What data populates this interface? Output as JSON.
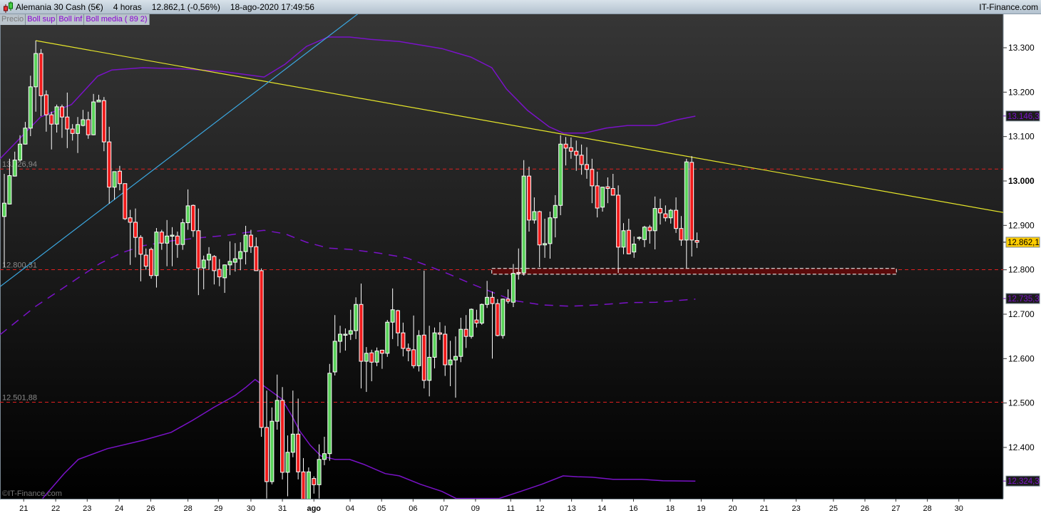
{
  "header": {
    "instrument": "Alemania 30 Cash (5€)",
    "timeframe": "4 horas",
    "quote": "12.862,1 (-0,56%)",
    "datetime": "18-ago-2020 17:49:56",
    "brand": "IT-Finance.com",
    "icon": "candlestick-icon"
  },
  "legend": {
    "price": "Precio",
    "boll_sup": "Boll sup",
    "boll_inf": "Boll inf",
    "boll_media": "Boll media ( 89 2)"
  },
  "watermark": "©IT-Finance.com",
  "colors": {
    "up": "#5ad35a",
    "down": "#f01c1c",
    "bollinger": "#7a12c8",
    "trendline_yellow": "#e6e62a",
    "trendline_blue": "#3ba7e0",
    "level_line": "#e02020",
    "last_price_bg": "#ffcc00"
  },
  "chart_data": {
    "type": "candlestick",
    "title": "",
    "ylim": [
      12285,
      13380
    ],
    "y_ticks": [
      {
        "value": 13300,
        "label": "13.300"
      },
      {
        "value": 13200,
        "label": "13.200"
      },
      {
        "value": 13100,
        "label": "13.100"
      },
      {
        "value": 13000,
        "label": "13.000",
        "bold": true
      },
      {
        "value": 12900,
        "label": "12.900"
      },
      {
        "value": 12800,
        "label": "12.800"
      },
      {
        "value": 12700,
        "label": "12.700"
      },
      {
        "value": 12600,
        "label": "12.600"
      },
      {
        "value": 12500,
        "label": "12.500"
      },
      {
        "value": 12400,
        "label": "12.400"
      }
    ],
    "x_ticks": [
      {
        "bar": 4.7,
        "label": "21"
      },
      {
        "bar": 10.8,
        "label": "22"
      },
      {
        "bar": 16.8,
        "label": "23"
      },
      {
        "bar": 22.9,
        "label": "24"
      },
      {
        "bar": 28.9,
        "label": "26"
      },
      {
        "bar": 36.0,
        "label": "28"
      },
      {
        "bar": 41.8,
        "label": "29"
      },
      {
        "bar": 48.0,
        "label": "30"
      },
      {
        "bar": 54.0,
        "label": "31"
      },
      {
        "bar": 60.0,
        "label": "ago",
        "bold": true
      },
      {
        "bar": 66.9,
        "label": "04"
      },
      {
        "bar": 72.9,
        "label": "05"
      },
      {
        "bar": 78.9,
        "label": "06"
      },
      {
        "bar": 84.8,
        "label": "07"
      },
      {
        "bar": 90.8,
        "label": "09"
      },
      {
        "bar": 97.5,
        "label": "11"
      },
      {
        "bar": 103.1,
        "label": "12"
      },
      {
        "bar": 109.1,
        "label": "13"
      },
      {
        "bar": 114.9,
        "label": "14"
      },
      {
        "bar": 120.9,
        "label": "16"
      },
      {
        "bar": 127.9,
        "label": "18"
      },
      {
        "bar": 133.8,
        "label": "19"
      },
      {
        "bar": 139.8,
        "label": "20"
      },
      {
        "bar": 145.8,
        "label": "21"
      },
      {
        "bar": 151.9,
        "label": "23"
      },
      {
        "bar": 159.0,
        "label": "25"
      },
      {
        "bar": 165.0,
        "label": "26"
      },
      {
        "bar": 170.9,
        "label": "27"
      },
      {
        "bar": 176.9,
        "label": "28"
      },
      {
        "bar": 182.9,
        "label": "30"
      }
    ],
    "ohlc_columns": [
      "open",
      "high",
      "low",
      "close"
    ],
    "candles": [
      [
        12920,
        13016,
        12806,
        12950
      ],
      [
        12948,
        13050,
        12947,
        13012
      ],
      [
        13011,
        13066,
        13010,
        13047
      ],
      [
        13047,
        13103,
        13044,
        13083
      ],
      [
        13083,
        13133,
        13082,
        13119
      ],
      [
        13119,
        13237,
        13101,
        13212
      ],
      [
        13212,
        13316,
        13156,
        13287
      ],
      [
        13287,
        13297,
        13146,
        13192
      ],
      [
        13194,
        13204,
        13111,
        13149
      ],
      [
        13149,
        13156,
        13071,
        13128
      ],
      [
        13128,
        13172,
        13109,
        13167
      ],
      [
        13167,
        13172,
        13097,
        13144
      ],
      [
        13144,
        13199,
        13074,
        13117
      ],
      [
        13117,
        13128,
        13091,
        13107
      ],
      [
        13107,
        13144,
        13063,
        13127
      ],
      [
        13125,
        13160,
        13123,
        13138
      ],
      [
        13138,
        13156,
        13095,
        13104
      ],
      [
        13104,
        13196,
        13103,
        13178
      ],
      [
        13178,
        13194,
        13178,
        13182
      ],
      [
        13181,
        13189,
        13067,
        13088
      ],
      [
        13088,
        13122,
        12949,
        12986
      ],
      [
        12986,
        13021,
        12958,
        13021
      ],
      [
        13022,
        13034,
        12979,
        12994
      ],
      [
        12994,
        12994,
        12912,
        12915
      ],
      [
        12917,
        12935,
        12811,
        12907
      ],
      [
        12907,
        12938,
        12828,
        12873
      ],
      [
        12873,
        12878,
        12774,
        12835
      ],
      [
        12833,
        12848,
        12800,
        12808
      ],
      [
        12846,
        12850,
        12780,
        12787
      ],
      [
        12787,
        12894,
        12760,
        12885
      ],
      [
        12885,
        12890,
        12845,
        12860
      ],
      [
        12860,
        12912,
        12808,
        12876
      ],
      [
        12876,
        12896,
        12808,
        12878
      ],
      [
        12876,
        12886,
        12827,
        12857
      ],
      [
        12857,
        12915,
        12845,
        12906
      ],
      [
        12906,
        12981,
        12890,
        12944
      ],
      [
        12945,
        12947,
        12874,
        12888
      ],
      [
        12888,
        12938,
        12743,
        12804
      ],
      [
        12804,
        12832,
        12756,
        12822
      ],
      [
        12822,
        12851,
        12800,
        12835
      ],
      [
        12830,
        12833,
        12767,
        12798
      ],
      [
        12801,
        12824,
        12763,
        12784
      ],
      [
        12782,
        12812,
        12748,
        12811
      ],
      [
        12811,
        12864,
        12788,
        12819
      ],
      [
        12817,
        12860,
        12796,
        12825
      ],
      [
        12825,
        12862,
        12799,
        12841
      ],
      [
        12841,
        12899,
        12812,
        12878
      ],
      [
        12878,
        12890,
        12838,
        12852
      ],
      [
        12852,
        12873,
        12798,
        12798
      ],
      [
        12798,
        12803,
        12424,
        12445
      ],
      [
        12445,
        12528,
        12285,
        12323
      ],
      [
        12323,
        12490,
        12317,
        12459
      ],
      [
        12459,
        12564,
        12440,
        12506
      ],
      [
        12506,
        12536,
        12328,
        12344
      ],
      [
        12344,
        12427,
        12290,
        12389
      ],
      [
        12389,
        12528,
        12378,
        12430
      ],
      [
        12430,
        12510,
        12328,
        12345
      ],
      [
        12345,
        12376,
        12270,
        12280
      ],
      [
        12280,
        12355,
        12270,
        12345
      ],
      [
        12330,
        12335,
        12296,
        12316
      ],
      [
        12316,
        12407,
        12285,
        12373
      ],
      [
        12373,
        12424,
        12360,
        12386
      ],
      [
        12386,
        12588,
        12370,
        12567
      ],
      [
        12570,
        12698,
        12562,
        12639
      ],
      [
        12639,
        12674,
        12613,
        12655
      ],
      [
        12655,
        12668,
        12618,
        12655
      ],
      [
        12655,
        12710,
        12642,
        12663
      ],
      [
        12663,
        12738,
        12644,
        12722
      ],
      [
        12722,
        12769,
        12533,
        12594
      ],
      [
        12594,
        12626,
        12525,
        12612
      ],
      [
        12613,
        12620,
        12549,
        12592
      ],
      [
        12592,
        12625,
        12583,
        12617
      ],
      [
        12619,
        12620,
        12577,
        12612
      ],
      [
        12612,
        12687,
        12604,
        12682
      ],
      [
        12682,
        12758,
        12644,
        12710
      ],
      [
        12708,
        12710,
        12628,
        12658
      ],
      [
        12658,
        12681,
        12605,
        12623
      ],
      [
        12623,
        12634,
        12594,
        12618
      ],
      [
        12620,
        12697,
        12578,
        12584
      ],
      [
        12584,
        12664,
        12571,
        12652
      ],
      [
        12653,
        12798,
        12533,
        12551
      ],
      [
        12551,
        12674,
        12515,
        12603
      ],
      [
        12603,
        12670,
        12578,
        12658
      ],
      [
        12658,
        12682,
        12642,
        12655
      ],
      [
        12655,
        12674,
        12561,
        12586
      ],
      [
        12586,
        12640,
        12538,
        12597
      ],
      [
        12597,
        12650,
        12512,
        12605
      ],
      [
        12605,
        12692,
        12592,
        12666
      ],
      [
        12666,
        12698,
        12624,
        12650
      ],
      [
        12650,
        12713,
        12645,
        12711
      ],
      [
        12687,
        12710,
        12670,
        12680
      ],
      [
        12680,
        12724,
        12676,
        12722
      ],
      [
        12722,
        12775,
        12714,
        12738
      ],
      [
        12738,
        12751,
        12600,
        12724
      ],
      [
        12724,
        12734,
        12650,
        12652
      ],
      [
        12652,
        12735,
        12645,
        12734
      ],
      [
        12734,
        12756,
        12724,
        12729
      ],
      [
        12727,
        12813,
        12716,
        12792
      ],
      [
        12794,
        12848,
        12778,
        12793
      ],
      [
        12793,
        13047,
        12787,
        13011
      ],
      [
        13011,
        13032,
        12886,
        12912
      ],
      [
        12912,
        12963,
        12904,
        12931
      ],
      [
        12931,
        12933,
        12806,
        12856
      ],
      [
        12856,
        12915,
        12827,
        12859
      ],
      [
        12859,
        12931,
        12825,
        12917
      ],
      [
        12917,
        12968,
        12873,
        12945
      ],
      [
        12945,
        13103,
        12923,
        13083
      ],
      [
        13083,
        13099,
        13035,
        13074
      ],
      [
        13075,
        13098,
        13050,
        13067
      ],
      [
        13067,
        13091,
        13023,
        13058
      ],
      [
        13058,
        13082,
        13014,
        13037
      ],
      [
        13037,
        13076,
        13005,
        13026
      ],
      [
        13026,
        13050,
        12950,
        12989
      ],
      [
        12989,
        13021,
        12918,
        12939
      ],
      [
        12941,
        12987,
        12931,
        12986
      ],
      [
        12987,
        13008,
        12950,
        12983
      ],
      [
        12983,
        13016,
        12968,
        12968
      ],
      [
        12968,
        12990,
        12793,
        12851
      ],
      [
        12851,
        12905,
        12835,
        12888
      ],
      [
        12889,
        12915,
        12835,
        12836
      ],
      [
        12840,
        12875,
        12827,
        12858
      ],
      [
        12872,
        12875,
        12866,
        12873
      ],
      [
        12868,
        12899,
        12851,
        12896
      ],
      [
        12896,
        12901,
        12859,
        12888
      ],
      [
        12888,
        12965,
        12846,
        12938
      ],
      [
        12938,
        12960,
        12902,
        12928
      ],
      [
        12926,
        12945,
        12909,
        12917
      ],
      [
        12917,
        12937,
        12904,
        12934
      ],
      [
        12934,
        12963,
        12883,
        12893
      ],
      [
        12893,
        12921,
        12854,
        12867
      ],
      [
        12867,
        13050,
        12804,
        13043
      ],
      [
        13042,
        13056,
        12830,
        12867
      ],
      [
        12866,
        12884,
        12849,
        12862
      ]
    ],
    "bollinger": {
      "period": 89,
      "deviation": 2,
      "upper": [
        [
          0.2,
          13050
        ],
        [
          7.9,
          13144
        ],
        [
          13.8,
          13172
        ],
        [
          18.8,
          13236
        ],
        [
          21.5,
          13250
        ],
        [
          27.4,
          13255
        ],
        [
          35.5,
          13252
        ],
        [
          42.3,
          13247
        ],
        [
          50.5,
          13234
        ],
        [
          54.5,
          13263
        ],
        [
          58.6,
          13303
        ],
        [
          62.7,
          13324
        ],
        [
          66.8,
          13324
        ],
        [
          70.8,
          13319
        ],
        [
          76.3,
          13314
        ],
        [
          84.4,
          13298
        ],
        [
          89.9,
          13279
        ],
        [
          93.9,
          13255
        ],
        [
          96.7,
          13207
        ],
        [
          100.7,
          13159
        ],
        [
          104.8,
          13122
        ],
        [
          107.5,
          13108
        ],
        [
          111.6,
          13108
        ],
        [
          115.7,
          13119
        ],
        [
          119.8,
          13125
        ],
        [
          125.2,
          13125
        ],
        [
          129.3,
          13138
        ],
        [
          132.7,
          13146
        ]
      ],
      "middle": [
        [
          0.2,
          12654
        ],
        [
          7.0,
          12718
        ],
        [
          11.1,
          12750
        ],
        [
          15.1,
          12782
        ],
        [
          19.2,
          12814
        ],
        [
          23.3,
          12838
        ],
        [
          27.4,
          12854
        ],
        [
          32.8,
          12865
        ],
        [
          38.2,
          12872
        ],
        [
          43.7,
          12878
        ],
        [
          47.7,
          12885
        ],
        [
          50.5,
          12889
        ],
        [
          54.5,
          12881
        ],
        [
          58.6,
          12862
        ],
        [
          62.7,
          12849
        ],
        [
          66.8,
          12846
        ],
        [
          72.2,
          12838
        ],
        [
          77.6,
          12827
        ],
        [
          81.7,
          12809
        ],
        [
          85.8,
          12790
        ],
        [
          89.9,
          12769
        ],
        [
          93.9,
          12750
        ],
        [
          98.0,
          12731
        ],
        [
          103.4,
          12721
        ],
        [
          108.9,
          12718
        ],
        [
          114.3,
          12721
        ],
        [
          119.8,
          12726
        ],
        [
          125.2,
          12727
        ],
        [
          132.7,
          12734
        ]
      ],
      "lower": [
        [
          8.3,
          12285
        ],
        [
          12.4,
          12341
        ],
        [
          15.1,
          12373
        ],
        [
          20.6,
          12397
        ],
        [
          27.4,
          12416
        ],
        [
          32.8,
          12434
        ],
        [
          36.9,
          12461
        ],
        [
          40.9,
          12490
        ],
        [
          45.0,
          12517
        ],
        [
          47.1,
          12536
        ],
        [
          48.8,
          12553
        ],
        [
          51.1,
          12533
        ],
        [
          53.9,
          12509
        ],
        [
          55.9,
          12469
        ],
        [
          57.3,
          12437
        ],
        [
          59.3,
          12405
        ],
        [
          61.3,
          12381
        ],
        [
          64.0,
          12373
        ],
        [
          66.8,
          12373
        ],
        [
          69.5,
          12362
        ],
        [
          73.6,
          12341
        ],
        [
          76.3,
          12336
        ],
        [
          80.3,
          12317
        ],
        [
          84.4,
          12301
        ],
        [
          87.1,
          12285
        ],
        [
          95.3,
          12285
        ],
        [
          99.4,
          12301
        ],
        [
          103.4,
          12317
        ],
        [
          107.5,
          12336
        ],
        [
          110.2,
          12334
        ],
        [
          113.0,
          12333
        ],
        [
          117.0,
          12328
        ],
        [
          122.5,
          12328
        ],
        [
          126.5,
          12325
        ],
        [
          132.7,
          12324
        ]
      ]
    },
    "trendlines": [
      {
        "color": "yellow",
        "points": [
          [
            7,
            13316
          ],
          [
            191.4,
            12929
          ]
        ]
      },
      {
        "color": "blue",
        "points": [
          [
            0.2,
            12762
          ],
          [
            68.8,
            13380
          ]
        ]
      }
    ],
    "levels": [
      {
        "value": 13026.94,
        "label": "13.026,94"
      },
      {
        "value": 12800.31,
        "label": "12.800,31"
      },
      {
        "value": 12501.88,
        "label": "12.501,88"
      }
    ],
    "support_zone": {
      "from_bar": 93.9,
      "to_bar": 171.0,
      "low": 12790,
      "high": 12803
    },
    "price_tags": [
      {
        "value": 13146.3,
        "label": "13.146,3",
        "kind": "bollinger"
      },
      {
        "value": 12862.1,
        "label": "12.862,1",
        "kind": "last"
      },
      {
        "value": 12735.3,
        "label": "12.735,3",
        "kind": "bollinger"
      },
      {
        "value": 12324.3,
        "label": "12.324,3",
        "kind": "bollinger"
      }
    ]
  }
}
